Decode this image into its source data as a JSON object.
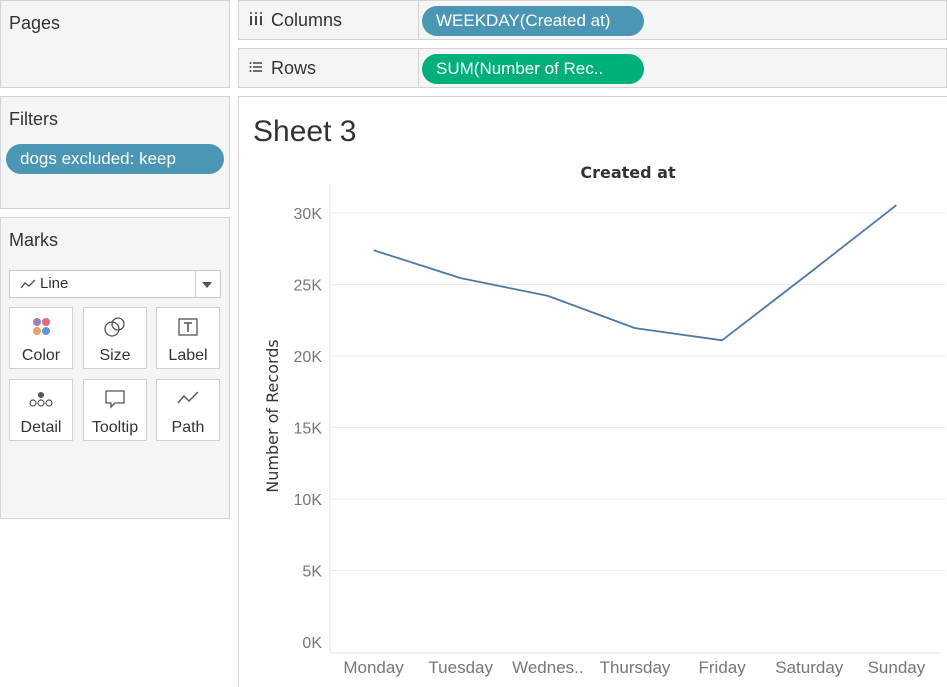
{
  "sidebar": {
    "pages_title": "Pages",
    "filters_title": "Filters",
    "filter_pill": "dogs excluded: keep",
    "marks_title": "Marks",
    "mark_type": "Line",
    "mark_buttons": [
      {
        "label": "Color",
        "icon": "color-icon"
      },
      {
        "label": "Size",
        "icon": "size-icon"
      },
      {
        "label": "Label",
        "icon": "label-icon"
      },
      {
        "label": "Detail",
        "icon": "detail-icon"
      },
      {
        "label": "Tooltip",
        "icon": "tooltip-icon"
      },
      {
        "label": "Path",
        "icon": "path-icon"
      }
    ]
  },
  "shelves": {
    "columns_label": "Columns",
    "columns_pill": "WEEKDAY(Created at)",
    "rows_label": "Rows",
    "rows_pill": "SUM(Number of Rec.."
  },
  "sheet": {
    "title": "Sheet 3"
  },
  "colors": {
    "line": "#4e79a7",
    "pill_dimension": "#4a96b4",
    "pill_measure": "#00b07a"
  },
  "chart_data": {
    "type": "line",
    "title": "Created at",
    "xlabel": "",
    "ylabel": "Number of Records",
    "categories": [
      "Monday",
      "Tuesday",
      "Wednes..",
      "Thursday",
      "Friday",
      "Saturday",
      "Sunday"
    ],
    "series": [
      {
        "values": [
          27400,
          25450,
          24200,
          21950,
          21100,
          25800,
          30550
        ]
      }
    ],
    "ylim": [
      0,
      30000
    ],
    "yticks": [
      0,
      5000,
      10000,
      15000,
      20000,
      25000,
      30000
    ],
    "ytick_labels": [
      "0K",
      "5K",
      "10K",
      "15K",
      "20K",
      "25K",
      "30K"
    ],
    "grid": true
  }
}
